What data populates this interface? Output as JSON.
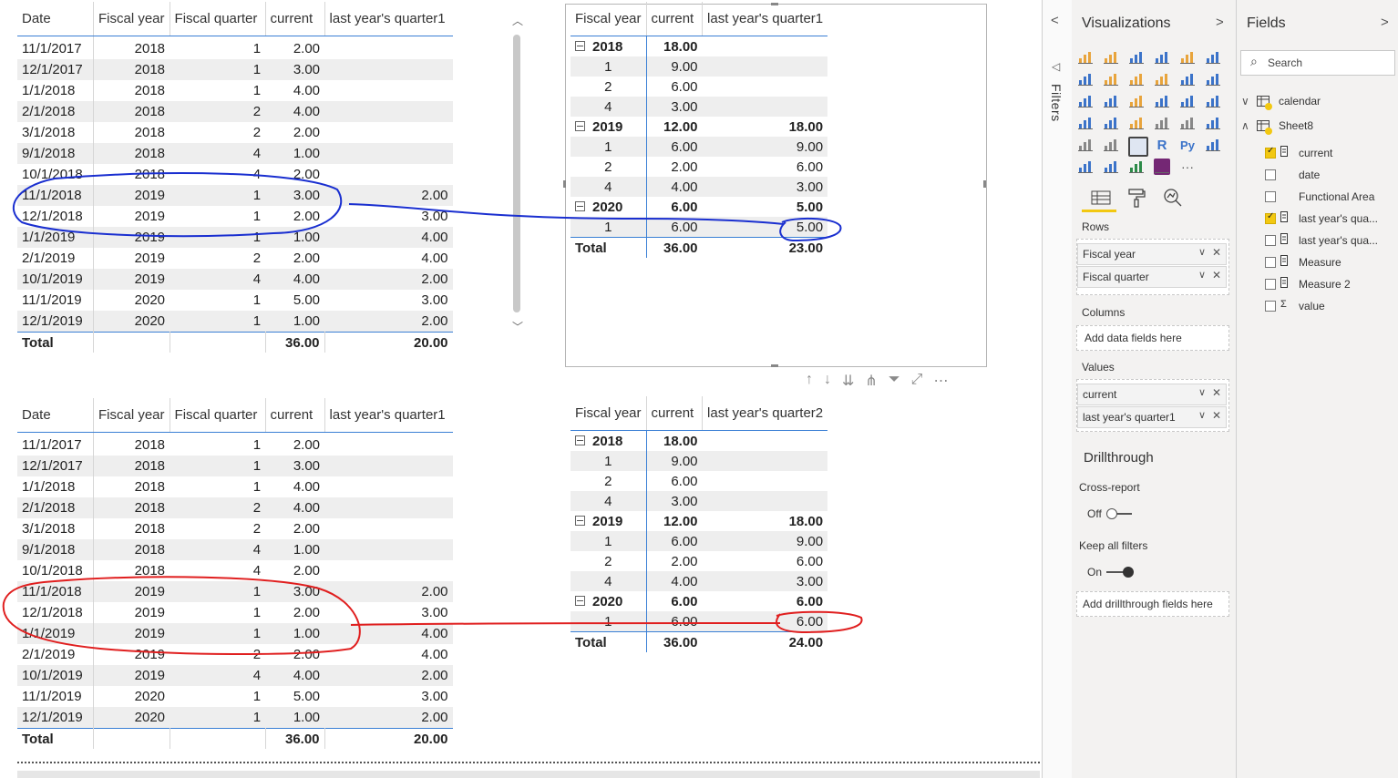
{
  "table1": {
    "headers": [
      "Date",
      "Fiscal year",
      "Fiscal quarter",
      "current",
      "last year's quarter1"
    ],
    "rows": [
      [
        "11/1/2017",
        "2018",
        "1",
        "2.00",
        ""
      ],
      [
        "12/1/2017",
        "2018",
        "1",
        "3.00",
        ""
      ],
      [
        "1/1/2018",
        "2018",
        "1",
        "4.00",
        ""
      ],
      [
        "2/1/2018",
        "2018",
        "2",
        "4.00",
        ""
      ],
      [
        "3/1/2018",
        "2018",
        "2",
        "2.00",
        ""
      ],
      [
        "9/1/2018",
        "2018",
        "4",
        "1.00",
        ""
      ],
      [
        "10/1/2018",
        "2018",
        "4",
        "2.00",
        ""
      ],
      [
        "11/1/2018",
        "2019",
        "1",
        "3.00",
        "2.00"
      ],
      [
        "12/1/2018",
        "2019",
        "1",
        "2.00",
        "3.00"
      ],
      [
        "1/1/2019",
        "2019",
        "1",
        "1.00",
        "4.00"
      ],
      [
        "2/1/2019",
        "2019",
        "2",
        "2.00",
        "4.00"
      ],
      [
        "10/1/2019",
        "2019",
        "4",
        "4.00",
        "2.00"
      ],
      [
        "11/1/2019",
        "2020",
        "1",
        "5.00",
        "3.00"
      ],
      [
        "12/1/2019",
        "2020",
        "1",
        "1.00",
        "2.00"
      ]
    ],
    "total": [
      "Total",
      "",
      "",
      "36.00",
      "20.00"
    ]
  },
  "table2": {
    "headers": [
      "Date",
      "Fiscal year",
      "Fiscal quarter",
      "current",
      "last year's quarter1"
    ],
    "rows": [
      [
        "11/1/2017",
        "2018",
        "1",
        "2.00",
        ""
      ],
      [
        "12/1/2017",
        "2018",
        "1",
        "3.00",
        ""
      ],
      [
        "1/1/2018",
        "2018",
        "1",
        "4.00",
        ""
      ],
      [
        "2/1/2018",
        "2018",
        "2",
        "4.00",
        ""
      ],
      [
        "3/1/2018",
        "2018",
        "2",
        "2.00",
        ""
      ],
      [
        "9/1/2018",
        "2018",
        "4",
        "1.00",
        ""
      ],
      [
        "10/1/2018",
        "2018",
        "4",
        "2.00",
        ""
      ],
      [
        "11/1/2018",
        "2019",
        "1",
        "3.00",
        "2.00"
      ],
      [
        "12/1/2018",
        "2019",
        "1",
        "2.00",
        "3.00"
      ],
      [
        "1/1/2019",
        "2019",
        "1",
        "1.00",
        "4.00"
      ],
      [
        "2/1/2019",
        "2019",
        "2",
        "2.00",
        "4.00"
      ],
      [
        "10/1/2019",
        "2019",
        "4",
        "4.00",
        "2.00"
      ],
      [
        "11/1/2019",
        "2020",
        "1",
        "5.00",
        "3.00"
      ],
      [
        "12/1/2019",
        "2020",
        "1",
        "1.00",
        "2.00"
      ]
    ],
    "total": [
      "Total",
      "",
      "",
      "36.00",
      "20.00"
    ]
  },
  "matrix1": {
    "headers": [
      "Fiscal year",
      "current",
      "last year's quarter1"
    ],
    "rows": [
      {
        "type": "year",
        "label": "2018",
        "current": "18.00",
        "last": ""
      },
      {
        "type": "q",
        "label": "1",
        "current": "9.00",
        "last": ""
      },
      {
        "type": "q",
        "label": "2",
        "current": "6.00",
        "last": ""
      },
      {
        "type": "q",
        "label": "4",
        "current": "3.00",
        "last": ""
      },
      {
        "type": "year",
        "label": "2019",
        "current": "12.00",
        "last": "18.00"
      },
      {
        "type": "q",
        "label": "1",
        "current": "6.00",
        "last": "9.00"
      },
      {
        "type": "q",
        "label": "2",
        "current": "2.00",
        "last": "6.00"
      },
      {
        "type": "q",
        "label": "4",
        "current": "4.00",
        "last": "3.00"
      },
      {
        "type": "year",
        "label": "2020",
        "current": "6.00",
        "last": "5.00"
      },
      {
        "type": "q",
        "label": "1",
        "current": "6.00",
        "last": "5.00"
      }
    ],
    "total": {
      "label": "Total",
      "current": "36.00",
      "last": "23.00"
    }
  },
  "matrix2": {
    "headers": [
      "Fiscal year",
      "current",
      "last year's quarter2"
    ],
    "rows": [
      {
        "type": "year",
        "label": "2018",
        "current": "18.00",
        "last": ""
      },
      {
        "type": "q",
        "label": "1",
        "current": "9.00",
        "last": ""
      },
      {
        "type": "q",
        "label": "2",
        "current": "6.00",
        "last": ""
      },
      {
        "type": "q",
        "label": "4",
        "current": "3.00",
        "last": ""
      },
      {
        "type": "year",
        "label": "2019",
        "current": "12.00",
        "last": "18.00"
      },
      {
        "type": "q",
        "label": "1",
        "current": "6.00",
        "last": "9.00"
      },
      {
        "type": "q",
        "label": "2",
        "current": "2.00",
        "last": "6.00"
      },
      {
        "type": "q",
        "label": "4",
        "current": "4.00",
        "last": "3.00"
      },
      {
        "type": "year",
        "label": "2020",
        "current": "6.00",
        "last": "6.00"
      },
      {
        "type": "q",
        "label": "1",
        "current": "6.00",
        "last": "6.00"
      }
    ],
    "total": {
      "label": "Total",
      "current": "36.00",
      "last": "24.00"
    }
  },
  "visual_toolbar": {
    "icons": [
      "drill-up-icon",
      "drill-down-icon",
      "expand-all-down-icon",
      "expand-next-level-icon",
      "filter-icon",
      "focus-mode-icon",
      "more-options-icon"
    ],
    "glyphs": [
      "↑",
      "↓",
      "⇊",
      "⋔",
      "⏷",
      "⤢",
      "⋯"
    ]
  },
  "filters_pane": {
    "label": "Filters",
    "collapse_glyph": "<"
  },
  "visualizations": {
    "title": "Visualizations",
    "expand_glyph": ">",
    "icon_names": [
      "stacked-bar-chart-icon",
      "stacked-column-chart-icon",
      "clustered-bar-chart-icon",
      "clustered-column-chart-icon",
      "100-stacked-bar-chart-icon",
      "100-stacked-column-chart-icon",
      "line-chart-icon",
      "area-chart-icon",
      "stacked-area-chart-icon",
      "line-clustered-column-icon",
      "line-stacked-column-icon",
      "ribbon-chart-icon",
      "waterfall-chart-icon",
      "scatter-chart-icon",
      "pie-chart-icon",
      "donut-chart-icon",
      "treemap-icon",
      "map-icon",
      "filled-map-icon",
      "funnel-icon",
      "gauge-icon",
      "card-icon",
      "multi-row-card-icon",
      "kpi-icon",
      "slicer-icon",
      "table-icon",
      "matrix-icon",
      "r-script-visual-icon",
      "python-visual-icon",
      "key-influencers-icon",
      "decomposition-tree-icon",
      "qa-visual-icon",
      "arcgis-map-icon",
      "power-apps-icon",
      "more-visuals-icon"
    ],
    "icon_colors": [
      "#e8a43c",
      "#e8a43c",
      "#3b73c9",
      "#3b73c9",
      "#e8a43c",
      "#3b73c9",
      "#3b73c9",
      "#e8a43c",
      "#e8a43c",
      "#e8a43c",
      "#3b73c9",
      "#3b73c9",
      "#3b73c9",
      "#3b73c9",
      "#e8a43c",
      "#3b73c9",
      "#3b73c9",
      "#3b73c9",
      "#3b73c9",
      "#3b73c9",
      "#e8a43c",
      "#888888",
      "#888888",
      "#3b73c9",
      "#888888",
      "#888888",
      "#3b73c9",
      "#3b73c9",
      "#3b73c9",
      "#3b73c9",
      "#3b73c9",
      "#3b73c9",
      "#2c8a48",
      "#742774",
      "#555555"
    ],
    "tabs": [
      "fields-tab-icon",
      "format-paint-roller-icon",
      "analytics-magnifier-icon"
    ],
    "rows_label": "Rows",
    "rows_fields": [
      "Fiscal year",
      "Fiscal quarter"
    ],
    "columns_label": "Columns",
    "columns_placeholder": "Add data fields here",
    "values_label": "Values",
    "values_fields": [
      "current",
      "last year's quarter1"
    ],
    "drillthrough_title": "Drillthrough",
    "cross_report_label": "Cross-report",
    "cross_report_state": "Off",
    "keep_filters_label": "Keep all filters",
    "keep_filters_state": "On",
    "drillthrough_placeholder": "Add drillthrough fields here"
  },
  "fields": {
    "title": "Fields",
    "expand_glyph": ">",
    "search_placeholder": "Search",
    "tables": [
      {
        "name": "calendar",
        "expanded": false
      },
      {
        "name": "Sheet8",
        "expanded": true
      }
    ],
    "items": [
      {
        "name": "current",
        "checked": true,
        "icon": "measure-icon"
      },
      {
        "name": "date",
        "checked": false,
        "icon": ""
      },
      {
        "name": "Functional Area",
        "checked": false,
        "icon": ""
      },
      {
        "name": "last year's qua...",
        "checked": true,
        "icon": "measure-icon"
      },
      {
        "name": "last year's qua...",
        "checked": false,
        "icon": "measure-icon"
      },
      {
        "name": "Measure",
        "checked": false,
        "icon": "measure-icon"
      },
      {
        "name": "Measure 2",
        "checked": false,
        "icon": "measure-icon"
      },
      {
        "name": "value",
        "checked": false,
        "icon": "sigma-icon"
      }
    ]
  },
  "annotation_colors": {
    "blue": "#1a2fd0",
    "red": "#e01f1f"
  }
}
